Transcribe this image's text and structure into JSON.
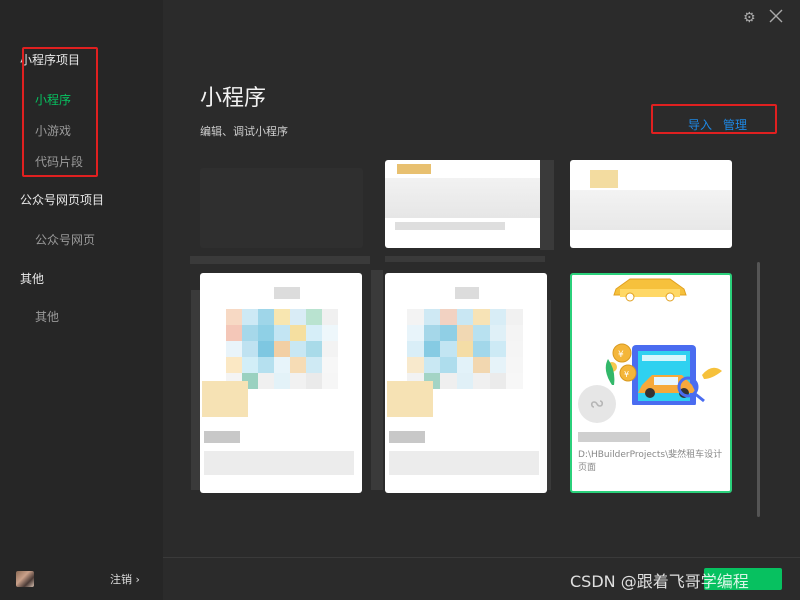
{
  "sidebar": {
    "sections": [
      {
        "label": "小程序项目",
        "items": [
          {
            "label": "小程序",
            "active": true
          },
          {
            "label": "小游戏",
            "active": false
          },
          {
            "label": "代码片段",
            "active": false
          }
        ]
      },
      {
        "label": "公众号网页项目",
        "items": [
          {
            "label": "公众号网页",
            "active": false
          }
        ]
      },
      {
        "label": "其他",
        "items": [
          {
            "label": "其他",
            "active": false
          }
        ]
      }
    ],
    "logout_label": "注销 ›"
  },
  "main": {
    "title": "小程序",
    "subtitle": "编辑、调试小程序",
    "import_label": "导入",
    "manage_label": "管理"
  },
  "selected_project": {
    "path": "D:\\HBuilderProjects\\斐然租车设计页面"
  },
  "watermark": "CSDN @跟着飞哥学编程",
  "colors": {
    "accent_green": "#07c160",
    "link_blue": "#1e88e5",
    "annotation_red": "#e02020",
    "selected_border": "#2bd07b"
  },
  "icons": {
    "settings": "gear-icon",
    "close": "close-icon",
    "new_project": "miniprogram-logo-icon"
  }
}
